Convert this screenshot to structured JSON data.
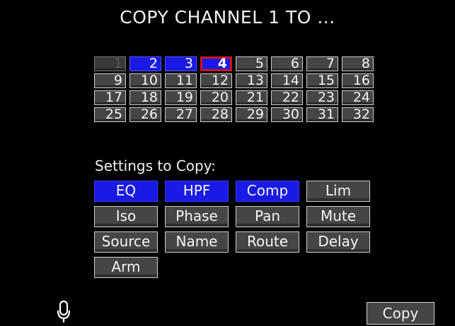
{
  "title": "COPY CHANNEL 1 TO ...",
  "channels": [
    {
      "label": "1",
      "state": "source"
    },
    {
      "label": "2",
      "state": "active"
    },
    {
      "label": "3",
      "state": "active"
    },
    {
      "label": "4",
      "state": "selected"
    },
    {
      "label": "5",
      "state": "off"
    },
    {
      "label": "6",
      "state": "off"
    },
    {
      "label": "7",
      "state": "off"
    },
    {
      "label": "8",
      "state": "off"
    },
    {
      "label": "9",
      "state": "off"
    },
    {
      "label": "10",
      "state": "off"
    },
    {
      "label": "11",
      "state": "off"
    },
    {
      "label": "12",
      "state": "off"
    },
    {
      "label": "13",
      "state": "off"
    },
    {
      "label": "14",
      "state": "off"
    },
    {
      "label": "15",
      "state": "off"
    },
    {
      "label": "16",
      "state": "off"
    },
    {
      "label": "17",
      "state": "off"
    },
    {
      "label": "18",
      "state": "off"
    },
    {
      "label": "19",
      "state": "off"
    },
    {
      "label": "20",
      "state": "off"
    },
    {
      "label": "21",
      "state": "off"
    },
    {
      "label": "22",
      "state": "off"
    },
    {
      "label": "23",
      "state": "off"
    },
    {
      "label": "24",
      "state": "off"
    },
    {
      "label": "25",
      "state": "off"
    },
    {
      "label": "26",
      "state": "off"
    },
    {
      "label": "27",
      "state": "off"
    },
    {
      "label": "28",
      "state": "off"
    },
    {
      "label": "29",
      "state": "off"
    },
    {
      "label": "30",
      "state": "off"
    },
    {
      "label": "31",
      "state": "off"
    },
    {
      "label": "32",
      "state": "off"
    }
  ],
  "settings_label": "Settings to Copy:",
  "settings": [
    {
      "label": "EQ",
      "on": true
    },
    {
      "label": "HPF",
      "on": true
    },
    {
      "label": "Comp",
      "on": true
    },
    {
      "label": "Lim",
      "on": false
    },
    {
      "label": "Iso",
      "on": false
    },
    {
      "label": "Phase",
      "on": false
    },
    {
      "label": "Pan",
      "on": false
    },
    {
      "label": "Mute",
      "on": false
    },
    {
      "label": "Source",
      "on": false
    },
    {
      "label": "Name",
      "on": false
    },
    {
      "label": "Route",
      "on": false
    },
    {
      "label": "Delay",
      "on": false
    },
    {
      "label": "Arm",
      "on": false
    }
  ],
  "copy_button": "Copy",
  "colors": {
    "active": "#1a1ae6",
    "selected_border": "#d11414",
    "inactive": "#454545"
  },
  "icons": {
    "bottom_left": "microphone-icon"
  }
}
